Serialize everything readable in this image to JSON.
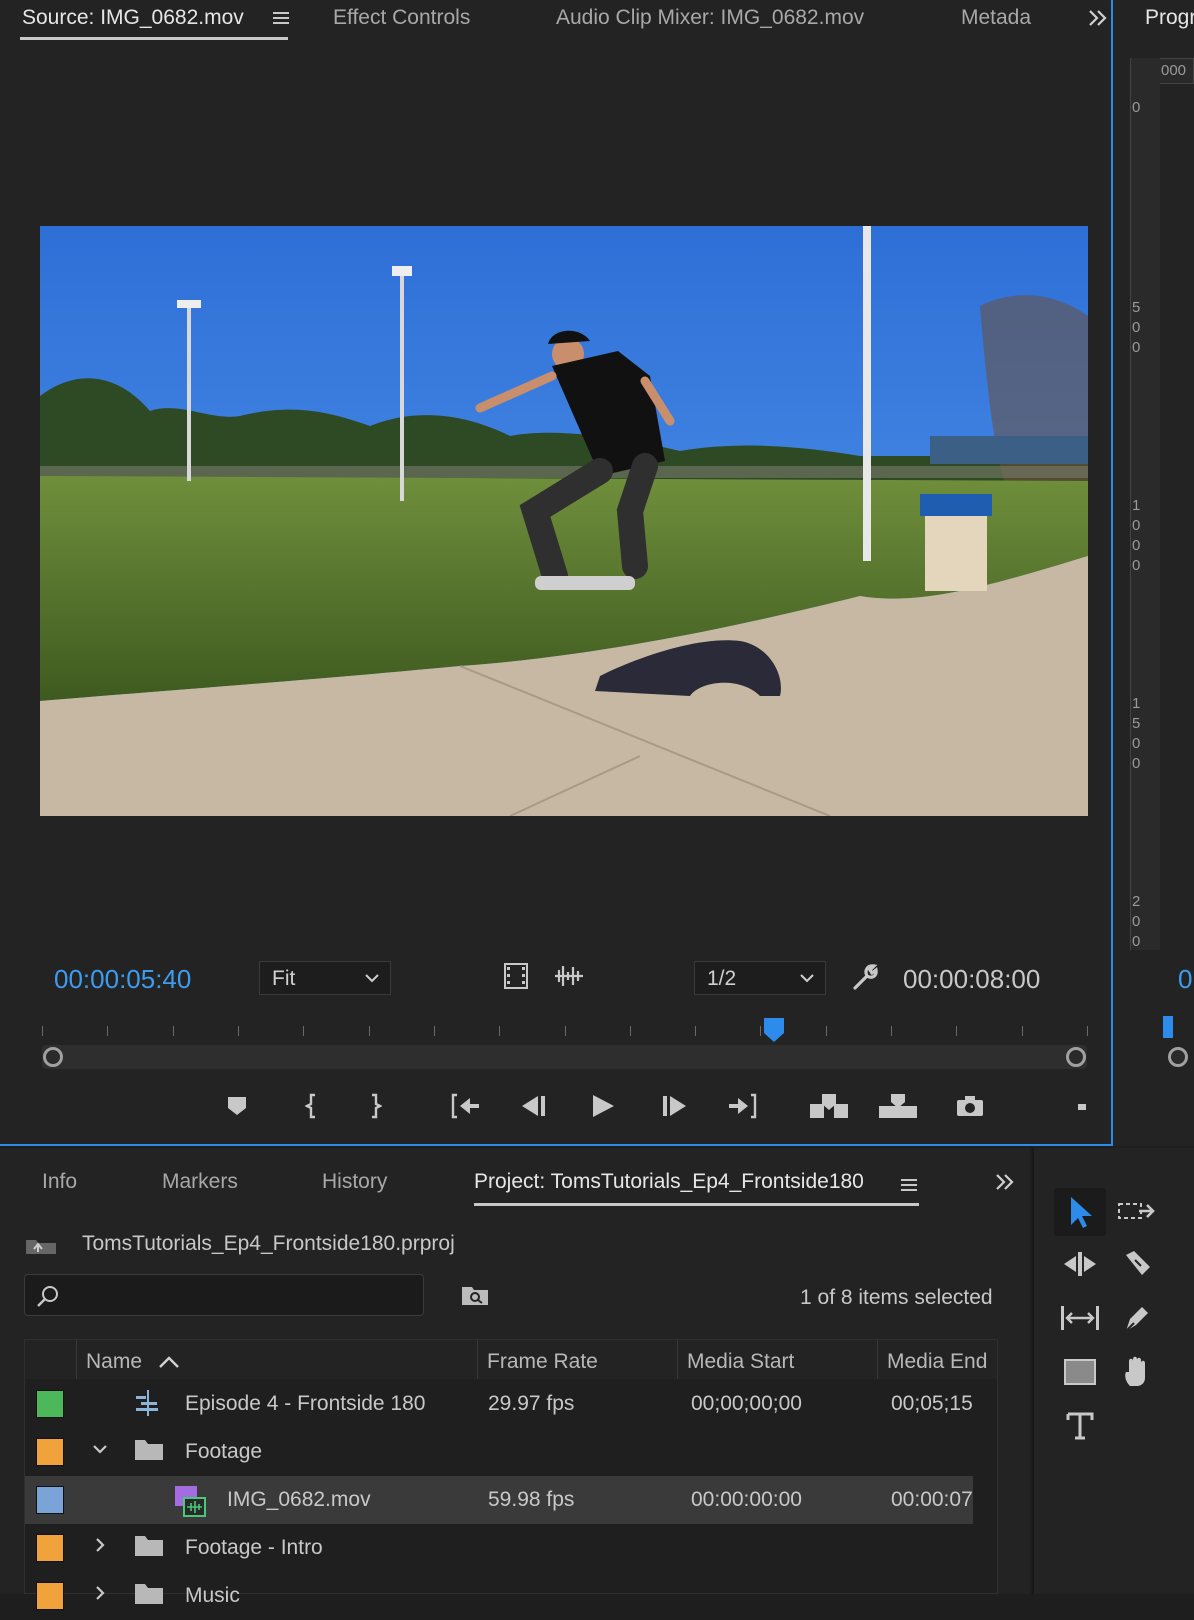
{
  "source_panel": {
    "tabs": [
      {
        "label": "Source: IMG_0682.mov",
        "menu_icon": "hamburger-icon"
      },
      {
        "label": "Effect Controls"
      },
      {
        "label": "Audio Clip Mixer: IMG_0682.mov"
      },
      {
        "label": "Metada"
      }
    ],
    "overflow_icon": "double-chevron-right-icon",
    "current_timecode": "00:00:05:40",
    "zoom_select": "Fit",
    "resolution_select": "1/2",
    "duration_timecode": "00:00:08:00",
    "playhead_fraction": 0.7,
    "transport": [
      "add-marker",
      "mark-in",
      "mark-out",
      "go-to-in",
      "step-back",
      "play",
      "step-forward",
      "go-to-out",
      "insert",
      "overwrite",
      "export-frame"
    ]
  },
  "program_panel": {
    "tab_label": "Progr",
    "ruler_top_label": "000",
    "ruler_marks": [
      "0",
      "5\n0\n0",
      "1\n0\n0\n0",
      "1\n5\n0\n0",
      "2\n0\n0"
    ],
    "timecode_stub": "0"
  },
  "project_panel": {
    "tabs": [
      "Info",
      "Markers",
      "History",
      "Project: TomsTutorials_Ep4_Frontside180"
    ],
    "project_file": "TomsTutorials_Ep4_Frontside180.prproj",
    "search_placeholder": "",
    "selection_status": "1 of 8 items selected",
    "columns": [
      "Name",
      "Frame Rate",
      "Media Start",
      "Media End"
    ],
    "rows": [
      {
        "color": "#4cb85a",
        "icon": "sequence-icon",
        "name": "Episode 4 - Frontside 180",
        "frame_rate": "29.97 fps",
        "media_start": "00;00;00;00",
        "media_end": "00;05;15",
        "indent": 1,
        "expand": ""
      },
      {
        "color": "#f0a33a",
        "icon": "folder-icon",
        "name": "Footage",
        "frame_rate": "",
        "media_start": "",
        "media_end": "",
        "indent": 1,
        "expand": "open"
      },
      {
        "color": "#7aa3d8",
        "icon": "video-clip-icon",
        "name": "IMG_0682.mov",
        "frame_rate": "59.98 fps",
        "media_start": "00:00:00:00",
        "media_end": "00:00:07",
        "indent": 2,
        "expand": "",
        "selected": true
      },
      {
        "color": "#f0a33a",
        "icon": "folder-icon",
        "name": "Footage - Intro",
        "frame_rate": "",
        "media_start": "",
        "media_end": "",
        "indent": 1,
        "expand": "closed"
      },
      {
        "color": "#f0a33a",
        "icon": "folder-icon",
        "name": "Music",
        "frame_rate": "",
        "media_start": "",
        "media_end": "",
        "indent": 1,
        "expand": "closed"
      }
    ]
  },
  "tools": [
    "selection-tool",
    "track-select-tool",
    "ripple-edit-tool",
    "razor-tool",
    "slip-tool",
    "pen-tool",
    "rectangle-tool",
    "hand-tool",
    "type-tool"
  ],
  "colors": {
    "accent": "#2d8ceb",
    "timecode": "#3d9cf0"
  }
}
